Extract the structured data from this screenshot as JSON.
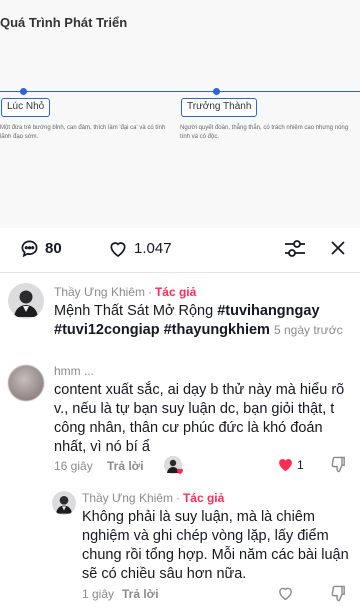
{
  "video": {
    "title": "Quá Trình Phát Triển",
    "stages": [
      {
        "label": "Lúc Nhỏ",
        "description": "Một đứa trẻ bướng bỉnh, can đảm, thích làm 'đại ca' và có tính lãnh đạo sớm."
      },
      {
        "label": "Trưởng Thành",
        "description": "Người quyết đoán, thẳng thắn, có trách nhiệm cao nhưng nóng tính và cô độc."
      }
    ]
  },
  "header": {
    "comment_count": "80",
    "like_count": "1.047"
  },
  "caption": {
    "author": "Thầy Ưng Khiêm",
    "author_tag": "Tác giả",
    "text": "Mệnh Thất Sát Mở Rộng ",
    "hashtags": [
      "#tuvihangngay",
      "#tuvi12congiap",
      "#thayungkhiem"
    ],
    "time": "5 ngày trước"
  },
  "comments": [
    {
      "author": "hmm ...",
      "text": "content xuất sắc, ai dạy b thử này mà hiểu rõ v., nếu là tự bạn suy luận dc, bạn giỏi thật, t công nhân, thân cư phúc đức là khó đoán nhất, vì nó bí ẩ",
      "time": "16 giây",
      "reply_label": "Trả lời",
      "likes": "1"
    },
    {
      "author": "Thầy Ưng Khiêm",
      "author_tag": "Tác giả",
      "text": "Không phải là suy luận, mà là chiêm nghiệm và ghi chép vòng lặp, lấy điểm chung rồi tổng hợp. Mỗi năm các bài luận sẽ có chiều sâu hơn nữa.",
      "time": "1 giây",
      "reply_label": "Trả lời"
    }
  ],
  "colors": {
    "accent": "#fe2c55",
    "timeline": "#2a66d9",
    "muted": "#8a8b91"
  }
}
